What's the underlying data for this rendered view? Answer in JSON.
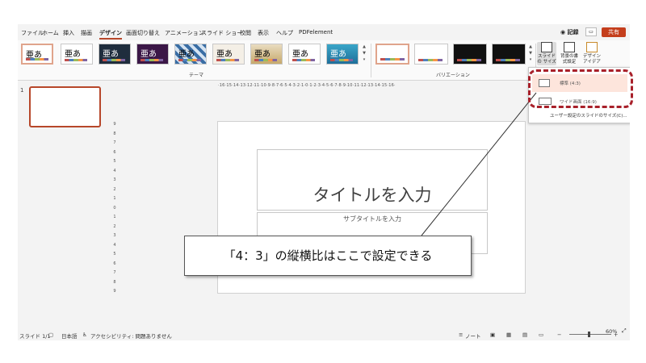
{
  "menu": {
    "tabs": [
      "ファイル",
      "ホーム",
      "挿入",
      "描画",
      "デザイン",
      "画面切り替え",
      "アニメーション",
      "スライド ショー",
      "校閲",
      "表示",
      "ヘルプ",
      "PDFelement"
    ],
    "active_index": 4,
    "record": "◉ 記録",
    "share": "共有"
  },
  "ribbon": {
    "themes_label": "テーマ",
    "variants_label": "バリエーション",
    "theme_glyph": "亜あ",
    "slide_size_label": "スライドの サイズ",
    "format_bg_label": "背景の書式設定",
    "designer_label": "デザイン アイデア"
  },
  "dropdown": {
    "standard": "標準 (4:3)",
    "widescreen": "ワイド画面 (16:9)",
    "custom": "ユーザー設定のスライドのサイズ(C)..."
  },
  "ruler": {
    "horizontal": "·16·15·14·13·12·11·10·9·8·7·6·5·4·3·2·1·0·1·2·3·4·5·6·7·8·9·10·11·12·13·14·15·16·",
    "vertical": [
      "9",
      "8",
      "7",
      "6",
      "5",
      "4",
      "3",
      "2",
      "1",
      "0",
      "1",
      "2",
      "3",
      "4",
      "5",
      "6",
      "7",
      "8",
      "9"
    ]
  },
  "thumbnail": {
    "number": "1"
  },
  "slide": {
    "title_placeholder": "タイトルを入力",
    "subtitle_placeholder": "サブタイトルを入力"
  },
  "callout": {
    "text": "「4：3」の縦横比はここで設定できる"
  },
  "status": {
    "slide_count": "スライド 1/1",
    "language": "日本語",
    "accessibility": "アクセシビリティ: 問題ありません",
    "notes": "ノート",
    "zoom": "60%"
  },
  "colors": {
    "accent": "#b7472a",
    "share": "#c43e1c",
    "highlight": "#fde5dc",
    "annotation": "#a8202a"
  }
}
